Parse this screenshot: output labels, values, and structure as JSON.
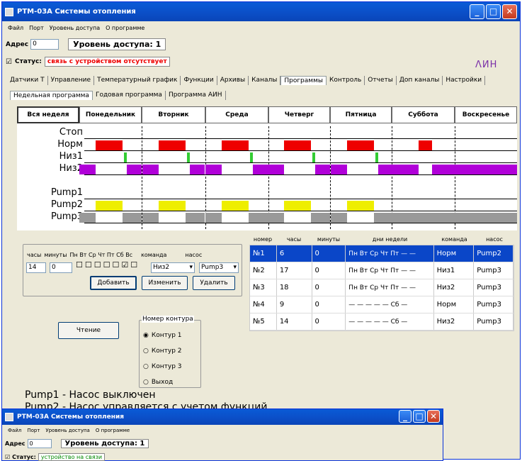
{
  "window": {
    "title": "РТМ-03А Системы отопления",
    "min": "_",
    "max": "□",
    "close": "✕"
  },
  "menu": [
    "Файл",
    "Порт",
    "Уровень доступа",
    "О программе"
  ],
  "address": {
    "label": "Адрес",
    "value": "0"
  },
  "access_level": "Уровень доступа: 1",
  "status": {
    "label": "Статус:",
    "text": "связь с устройством отсутствует",
    "text2": "устройство на связи"
  },
  "logo": "ΛИН",
  "tabs": [
    "Датчики Т",
    "Управление",
    "Температурный график",
    "Функции",
    "Архивы",
    "Каналы",
    "Программы",
    "Контроль",
    "Отчеты",
    "Доп каналы",
    "Настройки"
  ],
  "subtabs": [
    "Недельная программа",
    "Годовая программа",
    "Программа АИН"
  ],
  "days": [
    "Вся неделя",
    "Понедельник",
    "Вторник",
    "Среда",
    "Четверг",
    "Пятница",
    "Суббота",
    "Воскресенье"
  ],
  "rows": [
    "Стоп",
    "Норм",
    "Низ1",
    "Низ2",
    "Pump1",
    "Pump2",
    "Pump3"
  ],
  "form": {
    "hours_label": "часы",
    "minutes_label": "минуты",
    "days_label": "Пн Вт Ср Чт Пт Сб Вс",
    "command_label": "команда",
    "pump_label": "насос",
    "hours": "14",
    "minutes": "0",
    "command": "Низ2",
    "pump": "Pump3",
    "add": "Добавить",
    "edit": "Изменить",
    "delete": "Удалить"
  },
  "read_button": "Чтение",
  "contour": {
    "title": "Номер контура",
    "options": [
      "Контур 1",
      "Контур 2",
      "Контур 3",
      "Выход"
    ],
    "selected": 0
  },
  "table": {
    "headers": [
      "номер",
      "часы",
      "минуты",
      "дни недели",
      "команда",
      "насос"
    ],
    "rows": [
      [
        "№1",
        "6",
        "0",
        "Пн Вт Ср Чт Пт — —",
        "Норм",
        "Pump2"
      ],
      [
        "№2",
        "17",
        "0",
        "Пн Вт Ср Чт Пт — —",
        "Низ1",
        "Pump3"
      ],
      [
        "№3",
        "18",
        "0",
        "Пн Вт Ср Чт Пт — —",
        "Низ2",
        "Pump3"
      ],
      [
        "№4",
        "9",
        "0",
        "— — — — — Сб —",
        "Норм",
        "Pump3"
      ],
      [
        "№5",
        "14",
        "0",
        "— — — — — Сб —",
        "Низ2",
        "Pump3"
      ]
    ]
  },
  "legend": [
    "Pump1 - Насос выключен",
    "Pump2 - Насос управляется с учетом функций"
  ],
  "colors": {
    "norm": "#ee0000",
    "niz1": "#33cc33",
    "niz2": "#b000d8",
    "pump2": "#eeee00",
    "pump3": "#999999",
    "selected": "#0a46c8"
  }
}
